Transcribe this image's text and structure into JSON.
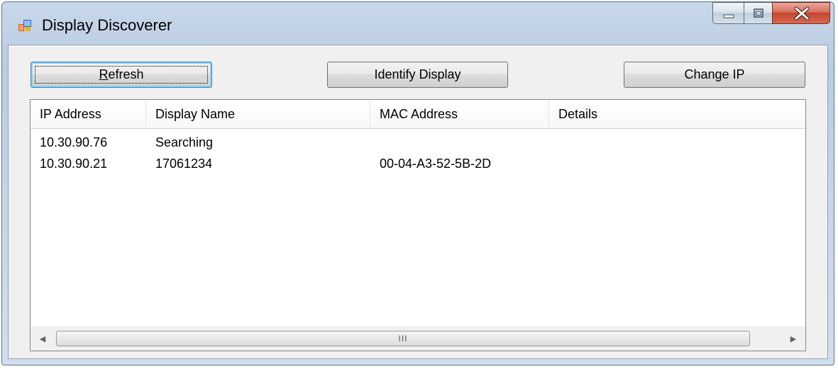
{
  "window": {
    "title": "Display Discoverer",
    "app_icon": "window-app-icon"
  },
  "caption_buttons": {
    "minimize_icon": "minimize-icon",
    "maximize_icon": "maximize-icon",
    "close_icon": "close-icon"
  },
  "toolbar": {
    "refresh_label": "Refresh",
    "refresh_mnemonic": "R",
    "identify_label": "Identify Display",
    "change_ip_label": "Change IP"
  },
  "list": {
    "columns": [
      "IP Address",
      "Display Name",
      "MAC Address",
      "Details"
    ],
    "rows": [
      [
        "10.30.90.76",
        "Searching",
        "",
        ""
      ],
      [
        "10.30.90.21",
        "17061234",
        "00-04-A3-52-5B-2D",
        ""
      ]
    ]
  },
  "scrollbar": {
    "left_icon": "scroll-left-arrow-icon",
    "right_icon": "scroll-right-arrow-icon",
    "grip": "III"
  }
}
